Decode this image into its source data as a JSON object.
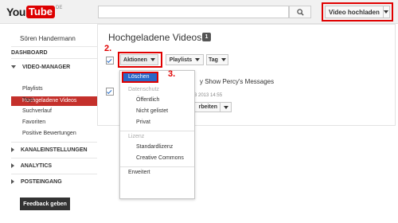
{
  "header": {
    "logo": {
      "you": "You",
      "tube": "Tube",
      "region": "DE"
    },
    "search": {
      "value": "",
      "placeholder": "",
      "icon": "search-icon"
    },
    "upload_label": "Video hochladen"
  },
  "steps": {
    "one": "1.",
    "two": "2.",
    "three": "3."
  },
  "sidebar": {
    "user": "Sören Handermann",
    "dashboard": "DASHBOARD",
    "video_manager": "VIDEO-MANAGER",
    "active_item": "Hochgeladene Videos",
    "items": [
      "Playlists",
      "Tags",
      "Suchverlauf",
      "Favoriten",
      "Positive Bewertungen"
    ],
    "channel_settings": "KANALEINSTELLUNGEN",
    "analytics": "ANALYTICS",
    "inbox": "POSTEINGANG",
    "feedback": "Feedback geben"
  },
  "main": {
    "title": "Hochgeladene Videos",
    "count": "1",
    "toolbar": {
      "actions": "Aktionen",
      "playlists": "Playlists",
      "tag": "Tag"
    },
    "video": {
      "title": "y Show Percy's Messages",
      "date": "3 2013 14:55",
      "edit": "rbeiten"
    },
    "dropdown": {
      "delete": "Löschen",
      "privacy_header": "Datenschutz",
      "public": "Öffentlich",
      "unlisted": "Nicht gelistet",
      "private": "Privat",
      "license_header": "Lizenz",
      "standard_license": "Standardlizenz",
      "creative_commons": "Creative Commons",
      "advanced": "Erweitert"
    }
  },
  "colors": {
    "highlight": "#e00000",
    "active_nav": "#c4302b",
    "selected_item": "#2867c8"
  }
}
